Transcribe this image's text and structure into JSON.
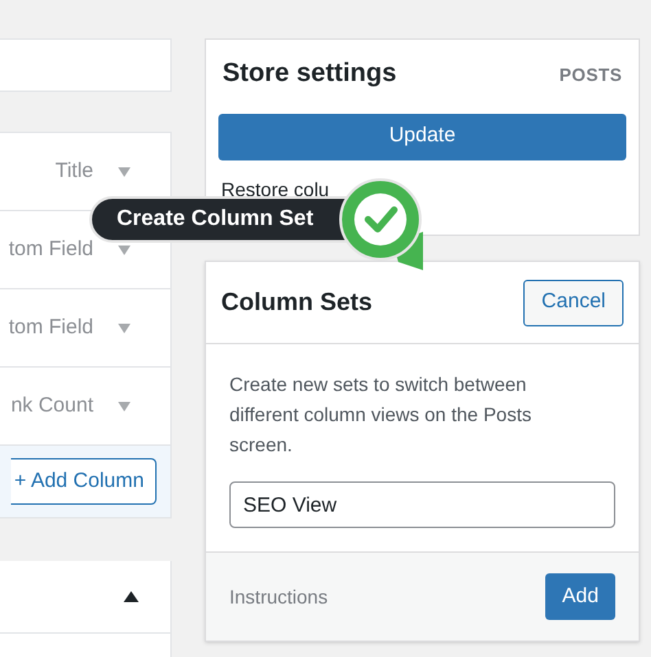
{
  "columns": [
    {
      "label": "Title"
    },
    {
      "label": "tom Field"
    },
    {
      "label": "tom Field"
    },
    {
      "label": "nk Count"
    }
  ],
  "add_column_button": "+ Add Column",
  "bottom_panel": {
    "expanded": true
  },
  "store_settings": {
    "title": "Store settings",
    "post_type": "POSTS",
    "update_button": "Update",
    "restore_link": "Restore colu"
  },
  "tooltip": {
    "label": "Create Column Set"
  },
  "column_sets": {
    "title": "Column Sets",
    "cancel_button": "Cancel",
    "description": "Create new sets to switch between different column views on the Posts screen.",
    "name_field": {
      "value": "SEO View"
    },
    "instructions_link": "Instructions",
    "add_button": "Add"
  }
}
